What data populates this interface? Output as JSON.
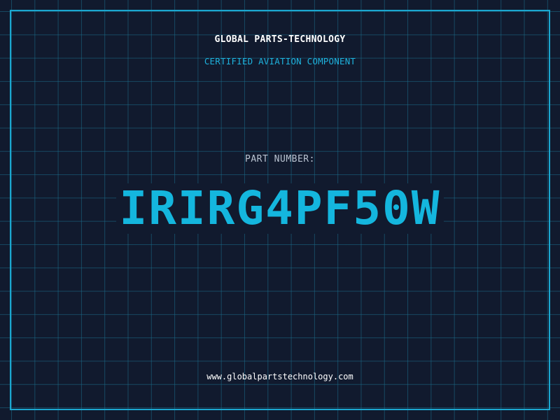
{
  "brand": {
    "name": "GLOBAL PARTS-TECHNOLOGY",
    "tagline": "CERTIFIED AVIATION COMPONENT"
  },
  "part": {
    "label": "PART NUMBER:",
    "number": "IRIRG4PF50W"
  },
  "footer": {
    "url": "www.globalpartstechnology.com"
  },
  "colors": {
    "background": "#111a2e",
    "grid": "#1b6e8c",
    "accent": "#14b6de",
    "frame": "#1ba7cf"
  }
}
